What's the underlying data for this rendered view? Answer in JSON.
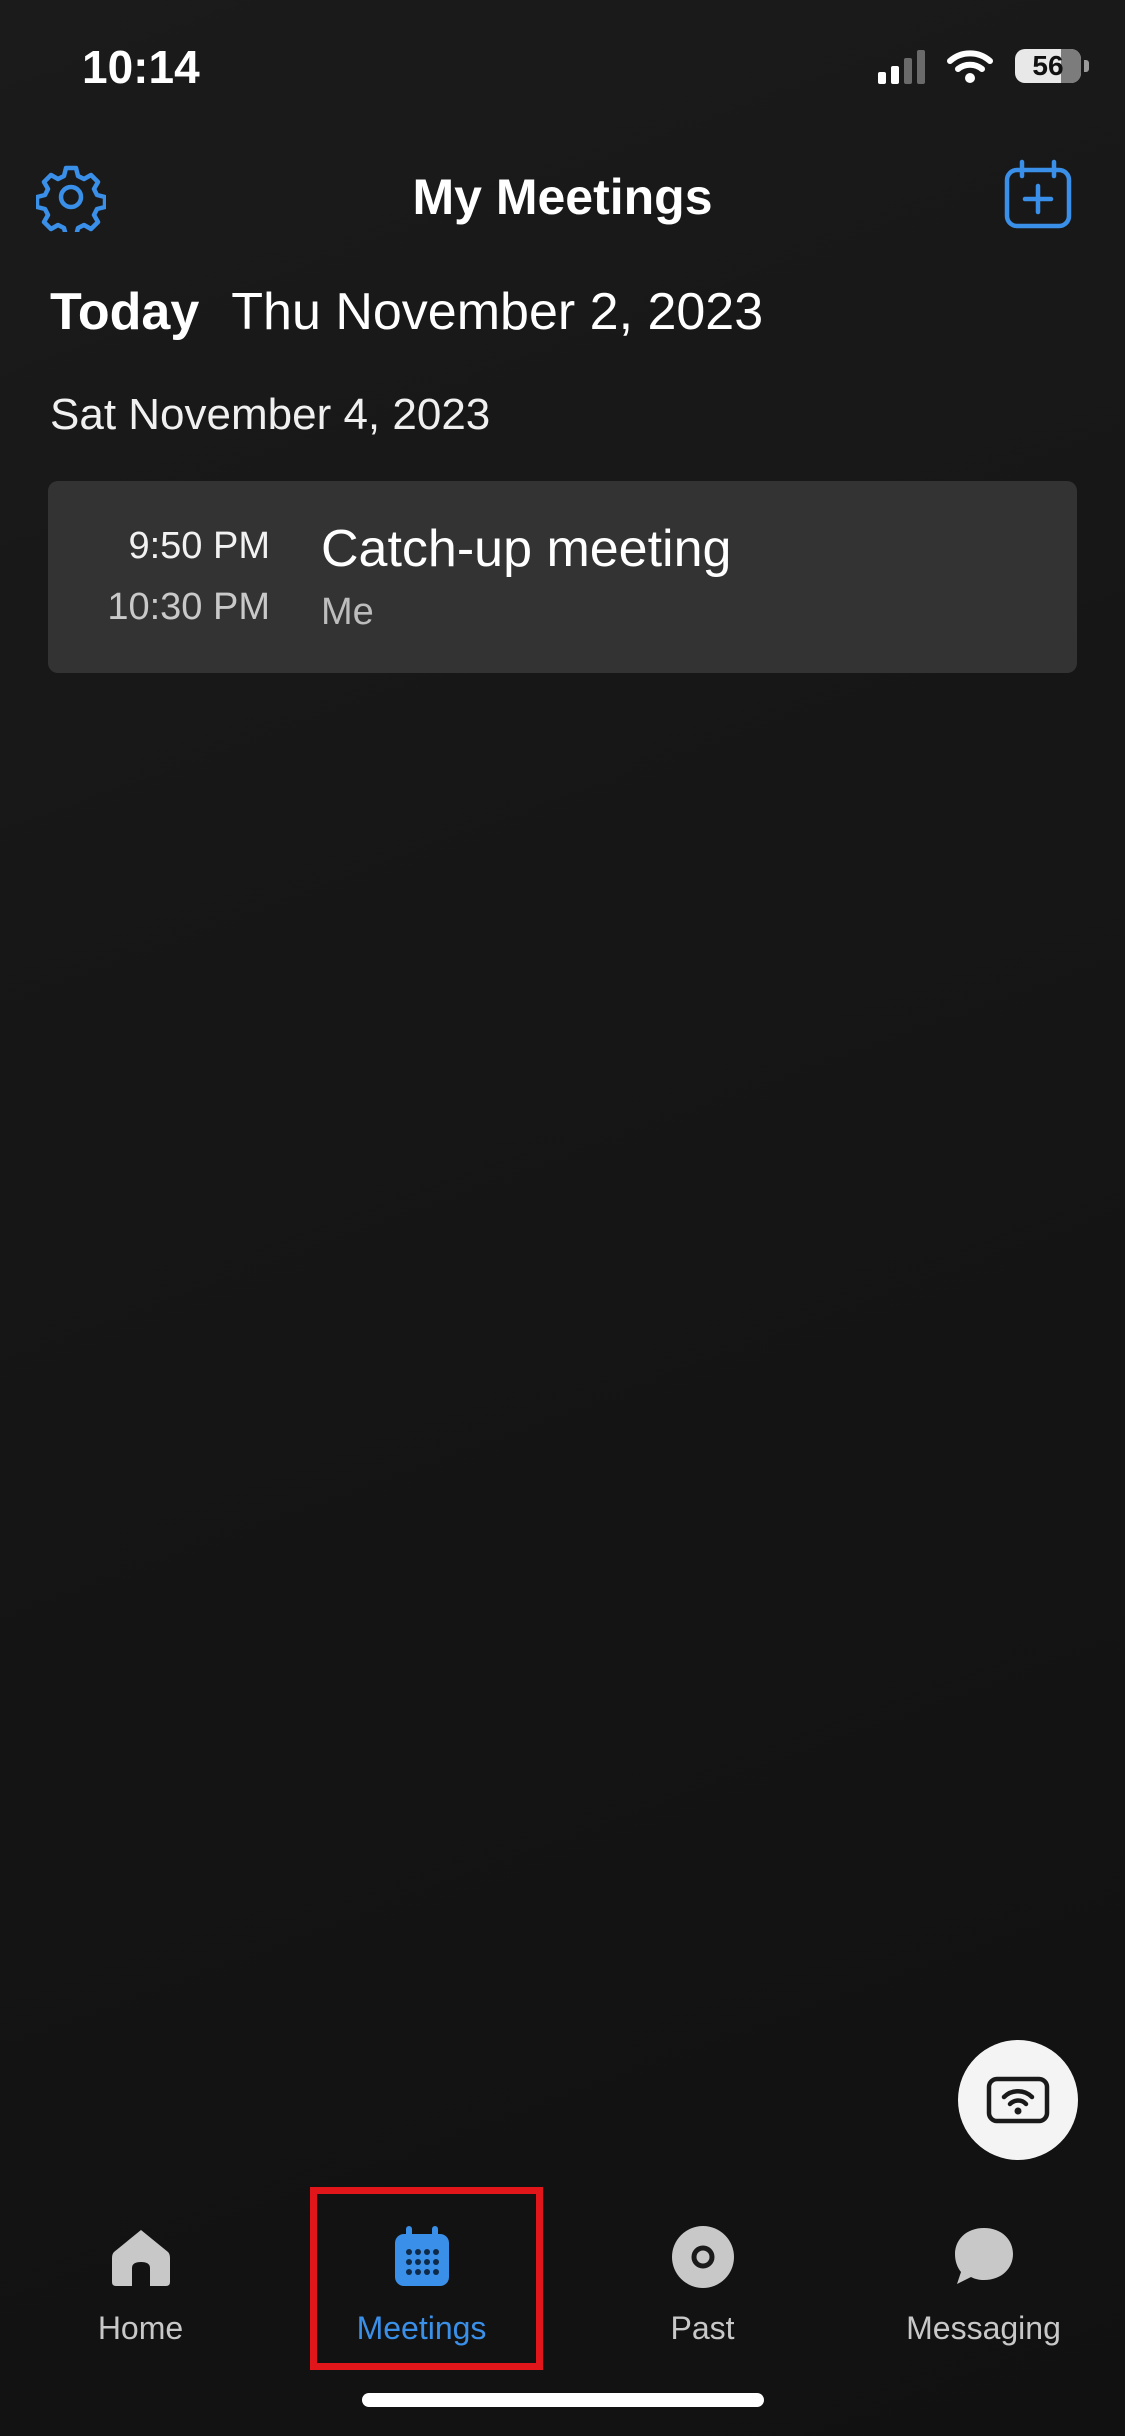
{
  "status_bar": {
    "time": "10:14",
    "battery": "56",
    "icons": [
      "cellular-signal-icon",
      "wifi-icon",
      "battery-icon"
    ]
  },
  "header": {
    "title": "My Meetings",
    "settings_icon": "gear-icon",
    "add_icon": "calendar-plus-icon"
  },
  "today": {
    "label": "Today",
    "date": "Thu November 2, 2023"
  },
  "sections": [
    {
      "date": "Sat November 4, 2023",
      "meetings": [
        {
          "start": "9:50 PM",
          "end": "10:30 PM",
          "title": "Catch-up meeting",
          "organizer": "Me"
        }
      ]
    }
  ],
  "fab": {
    "icon": "cast-wifi-icon"
  },
  "tabs": [
    {
      "label": "Home",
      "icon": "home-icon",
      "active": false
    },
    {
      "label": "Meetings",
      "icon": "calendar-icon",
      "active": true
    },
    {
      "label": "Past",
      "icon": "disc-icon",
      "active": false
    },
    {
      "label": "Messaging",
      "icon": "chat-bubble-icon",
      "active": false
    }
  ],
  "colors": {
    "accent": "#3a8fe8",
    "background": "#141414",
    "card": "#333333",
    "highlight": "#e0161b"
  }
}
